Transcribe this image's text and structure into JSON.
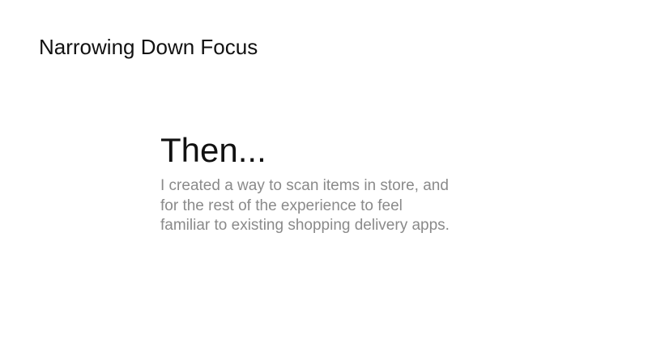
{
  "slide": {
    "title": "Narrowing Down Focus",
    "heading": "Then...",
    "body_lines": [
      "I created a way to scan items in store, and",
      "for the rest of the experience to feel",
      "familiar to existing shopping delivery apps."
    ]
  },
  "colors": {
    "background": "#ffffff",
    "title_text": "#111111",
    "body_text": "#8a8a8a"
  }
}
